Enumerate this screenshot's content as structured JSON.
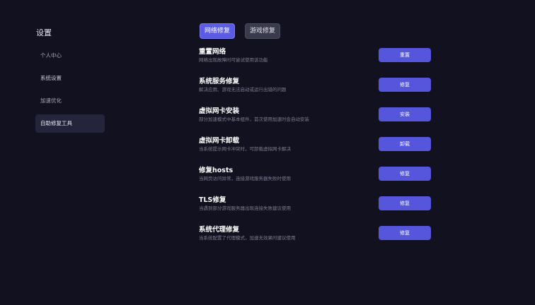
{
  "sidebar": {
    "title": "设置",
    "items": [
      {
        "label": "个人中心"
      },
      {
        "label": "系统设置"
      },
      {
        "label": "加速优化"
      },
      {
        "label": "自助修复工具"
      }
    ]
  },
  "tabs": [
    {
      "label": "网络修复"
    },
    {
      "label": "游戏修复"
    }
  ],
  "tools": [
    {
      "title": "重置网络",
      "desc": "网络出现故障时可尝试使用该功能",
      "button": "重置"
    },
    {
      "title": "系统服务修复",
      "desc": "解决应用、游戏无法启动或运行出错的问题",
      "button": "修复"
    },
    {
      "title": "虚拟网卡安装",
      "desc": "部分加速模式中基本组件，首次使用加速时会自动安装",
      "button": "安装"
    },
    {
      "title": "虚拟网卡卸载",
      "desc": "当系统提示网卡冲突时，可卸载虚拟网卡解决",
      "button": "卸载"
    },
    {
      "title": "修复hosts",
      "desc": "当网页访问异常，连接游戏服务器失败时使用",
      "button": "修复"
    },
    {
      "title": "TLS修复",
      "desc": "当遇到部分游戏服务器出现连接失败建议使用",
      "button": "修复"
    },
    {
      "title": "系统代理修复",
      "desc": "当系统配置了代理模式，加速无效果时建议使用",
      "button": "修复"
    }
  ],
  "colors": {
    "background": "#11111f",
    "accent": "#5656dd",
    "active_tab": "#5b5be6",
    "sidebar_active": "#24243a"
  }
}
